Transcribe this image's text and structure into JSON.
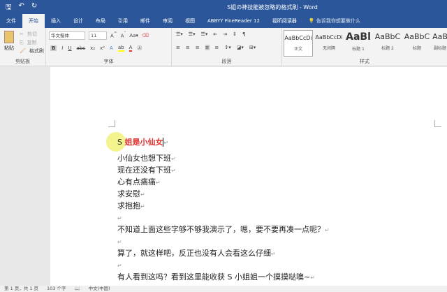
{
  "title": "S姐の神技能被忽略的格式刷 - Word",
  "tabs": [
    "文件",
    "开始",
    "插入",
    "设计",
    "布局",
    "引用",
    "邮件",
    "审阅",
    "视图",
    "ABBYY FineReader 12",
    "福昕阅读器"
  ],
  "tell_me": "告诉我你想要做什么",
  "clipboard": {
    "paste": "粘贴",
    "cut": "剪切",
    "copy": "复制",
    "format_painter": "格式刷",
    "label": "剪贴板"
  },
  "font": {
    "name": "华文楷体",
    "size": "11",
    "label": "字体"
  },
  "paragraph": {
    "label": "段落"
  },
  "styles": {
    "label": "样式",
    "items": [
      {
        "preview": "AaBbCcDi",
        "name": "正文"
      },
      {
        "preview": "AaBbCcDi",
        "name": "无间隔"
      },
      {
        "preview": "AaBl",
        "name": "标题 1"
      },
      {
        "preview": "AaBbC",
        "name": "标题 2"
      },
      {
        "preview": "AaBbC",
        "name": "标题"
      },
      {
        "preview": "AaB",
        "name": "副标题"
      }
    ]
  },
  "document": {
    "heading_prefix": "S ",
    "heading_rest": "姐是小仙女",
    "lines": [
      "小仙女也想下班",
      "现在还没有下班",
      "心有点痛痛",
      "求安慰",
      "求抱抱",
      "",
      "不知道上面这些字够不够我演示了，嗯，要不要再凑一点呢？",
      "",
      "算了，就这样吧，反正也没有人会看这么仔细",
      "",
      "有人看到这吗？看到这里能收获 S 小姐姐一个摸摸哒噢~"
    ]
  },
  "status": {
    "page": "第 1 页，共 1 页",
    "words": "103 个字",
    "language": "中文(中国)"
  }
}
